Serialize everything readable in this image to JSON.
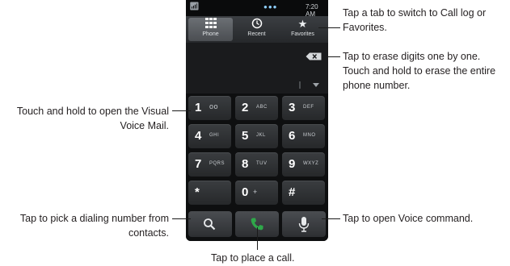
{
  "status_bar": {
    "time": "7:20 AM"
  },
  "tabs": [
    {
      "label": "Phone",
      "icon": "keypad-grid-icon",
      "selected": true
    },
    {
      "label": "Recent",
      "icon": "clock-icon",
      "selected": false
    },
    {
      "label": "Favorites",
      "icon": "star-icon",
      "selected": false
    }
  ],
  "keys": [
    {
      "digit": "1",
      "letters": "oo"
    },
    {
      "digit": "2",
      "letters": "ABC"
    },
    {
      "digit": "3",
      "letters": "DEF"
    },
    {
      "digit": "4",
      "letters": "GHI"
    },
    {
      "digit": "5",
      "letters": "JKL"
    },
    {
      "digit": "6",
      "letters": "MNO"
    },
    {
      "digit": "7",
      "letters": "PQRS"
    },
    {
      "digit": "8",
      "letters": "TUV"
    },
    {
      "digit": "9",
      "letters": "WXYZ"
    },
    {
      "digit": "*",
      "letters": ""
    },
    {
      "digit": "0",
      "letters": "+"
    },
    {
      "digit": "#",
      "letters": ""
    }
  ],
  "call_bar": {
    "icons": [
      "search-icon",
      "phone-icon",
      "microphone-icon"
    ]
  },
  "annotations": {
    "tabs_line1": "Tap a tab to switch to Call log or",
    "tabs_line2": "Favorites.",
    "erase_line1": "Tap to erase digits one by one.",
    "erase_line2": "Touch and hold to erase the entire",
    "erase_line3": "phone number.",
    "voicemail_line1": "Touch and hold to open the Visual",
    "voicemail_line2": "Voice Mail.",
    "contacts_line1": "Tap to pick a dialing number from",
    "contacts_line2": "contacts.",
    "voice_cmd": "Tap to open Voice command.",
    "call": "Tap to place a call."
  },
  "colors": {
    "call_green": "#2fa84a",
    "text": "#231f20"
  }
}
